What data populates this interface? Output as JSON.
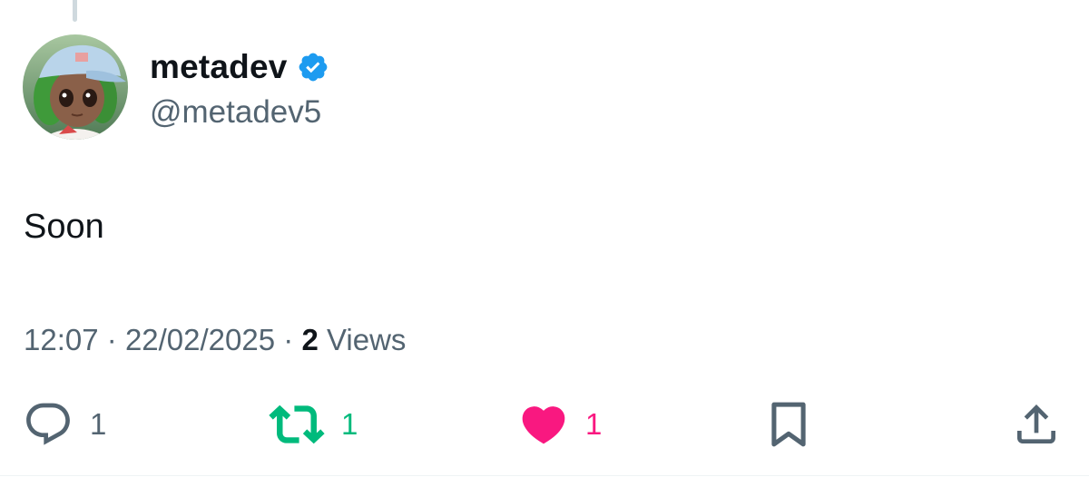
{
  "tweet": {
    "author": {
      "display_name": "metadev",
      "handle": "@metadev5",
      "verified": true,
      "verified_icon": "verified-badge-icon",
      "verified_color": "#1d9bf0",
      "avatar_description": "avatar"
    },
    "text": "Soon",
    "meta": {
      "time": "12:07",
      "separator": "·",
      "date": "22/02/2025",
      "views_count": "2",
      "views_label": "Views"
    },
    "actions": {
      "reply": {
        "icon": "reply-icon",
        "count": "1",
        "color": "#536471"
      },
      "retweet": {
        "icon": "retweet-icon",
        "count": "1",
        "color": "#00ba7c",
        "active": true
      },
      "like": {
        "icon": "heart-icon",
        "count": "1",
        "color": "#f91880",
        "active": true
      },
      "bookmark": {
        "icon": "bookmark-icon"
      },
      "share": {
        "icon": "share-icon"
      }
    }
  }
}
